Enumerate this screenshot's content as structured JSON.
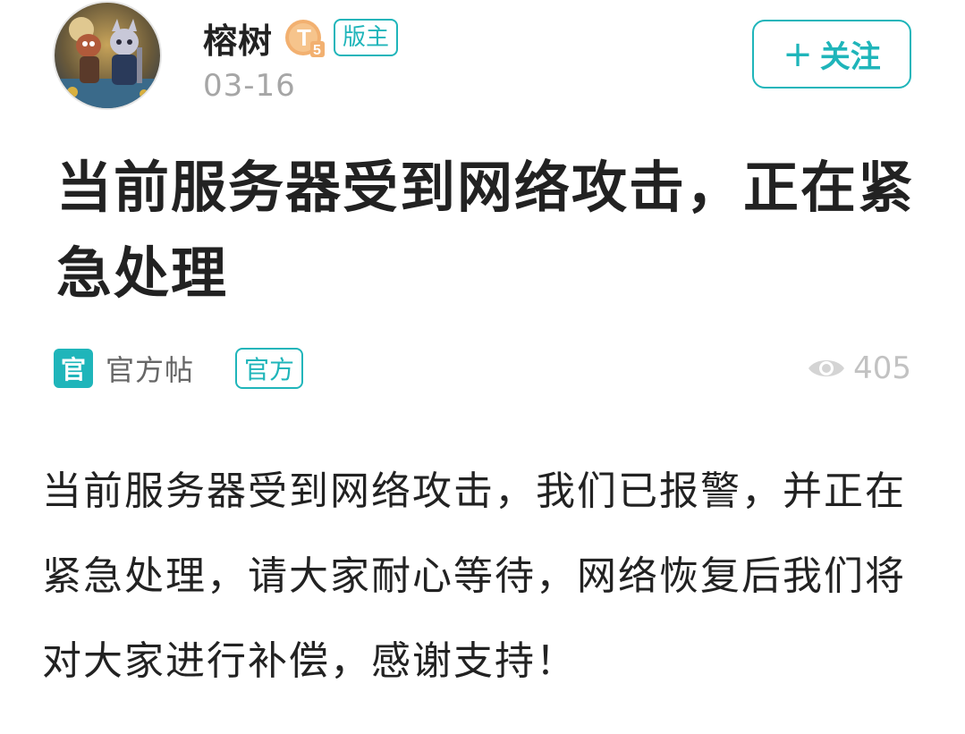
{
  "author": {
    "name": "榕树",
    "level_badge": "T5",
    "level_badge_letter": "T",
    "level_badge_number": "5",
    "role_badge": "版主",
    "date": "03-16",
    "avatar_icon": "game-character-avatar"
  },
  "follow": {
    "plus": "+",
    "label": "关注"
  },
  "post": {
    "title": "当前服务器受到网络攻击，正在紧急处理",
    "category_icon_text": "官",
    "category_text": "官方帖",
    "tag": "官方",
    "views": "405",
    "body": "当前服务器受到网络攻击，我们已报警，并正在紧急处理，请大家耐心等待，网络恢复后我们将对大家进行补偿，感谢支持！"
  },
  "colors": {
    "accent": "#1fb5ba",
    "text": "#222222",
    "muted": "#a6a6a6",
    "badge_gold": "#f0a860"
  }
}
